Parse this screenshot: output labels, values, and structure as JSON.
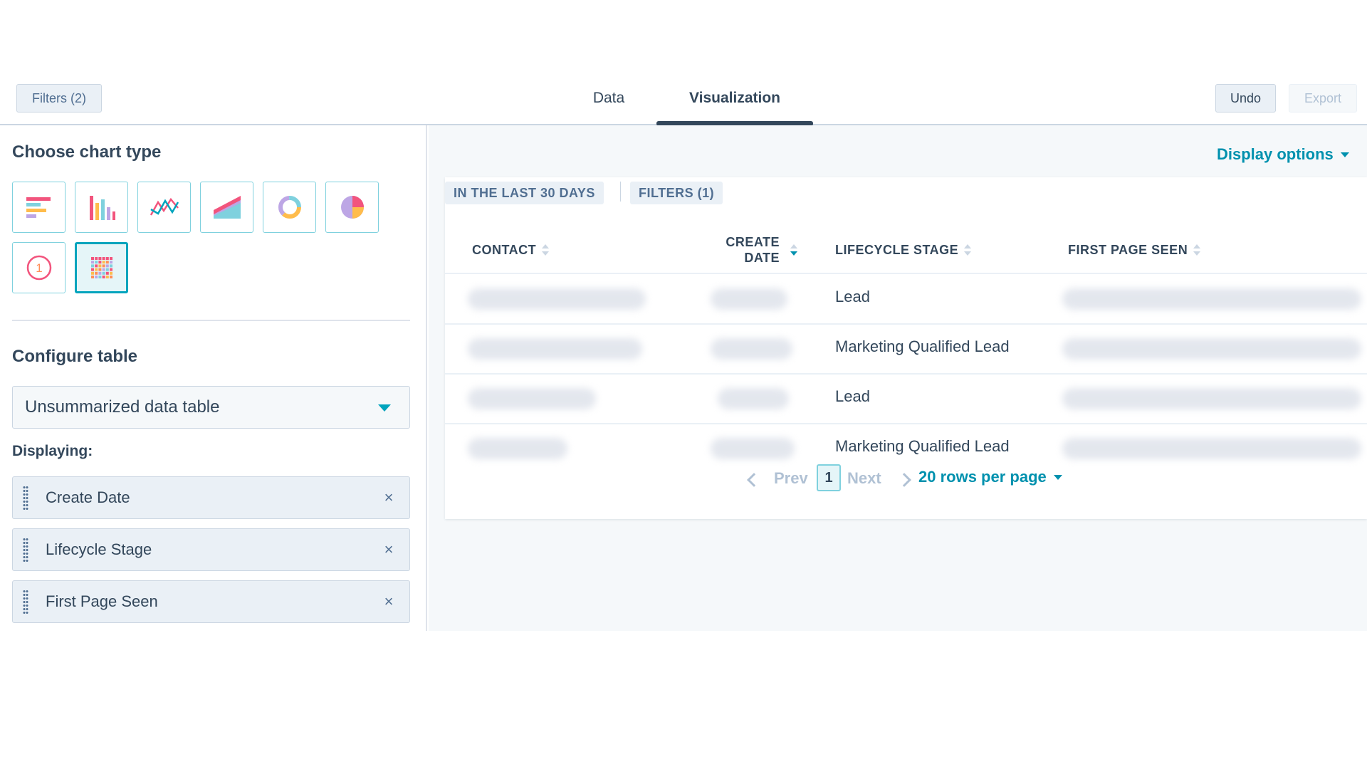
{
  "header": {
    "filters_label": "Filters (2)",
    "tabs": [
      {
        "label": "Data"
      },
      {
        "label": "Visualization"
      }
    ],
    "undo_label": "Undo",
    "export_label": "Export"
  },
  "left": {
    "chart_type_title": "Choose chart type",
    "chart_types": [
      {
        "icon": "horizontal-bar-chart-icon"
      },
      {
        "icon": "vertical-bar-chart-icon"
      },
      {
        "icon": "line-chart-icon"
      },
      {
        "icon": "area-chart-icon"
      },
      {
        "icon": "donut-chart-icon"
      },
      {
        "icon": "pie-chart-icon"
      },
      {
        "icon": "summary-number-icon",
        "glyph": "1"
      },
      {
        "icon": "table-chart-icon",
        "selected": true
      }
    ],
    "configure_title": "Configure table",
    "table_type": "Unsummarized data table",
    "displaying_label": "Displaying:",
    "fields": [
      {
        "label": "Create Date",
        "remove": "×"
      },
      {
        "label": "Lifecycle Stage",
        "remove": "×"
      },
      {
        "label": "First Page Seen",
        "remove": "×"
      }
    ]
  },
  "right": {
    "display_options": "Display options",
    "chips": [
      "IN THE LAST 30 DAYS",
      "FILTERS (1)"
    ],
    "columns": [
      "CONTACT",
      "CREATE",
      "DATE",
      "LIFECYCLE STAGE",
      "FIRST PAGE SEEN"
    ],
    "rows": [
      {
        "lifecycle": "Lead"
      },
      {
        "lifecycle": "Marketing Qualified Lead"
      },
      {
        "lifecycle": "Lead"
      },
      {
        "lifecycle": "Marketing Qualified Lead"
      }
    ],
    "pagination": {
      "prev": "Prev",
      "page": "1",
      "next": "Next",
      "rows_per_page": "20 rows per page"
    }
  },
  "colors": {
    "accent": "#00a4bd",
    "link": "#0091ae",
    "text": "#33475b"
  }
}
